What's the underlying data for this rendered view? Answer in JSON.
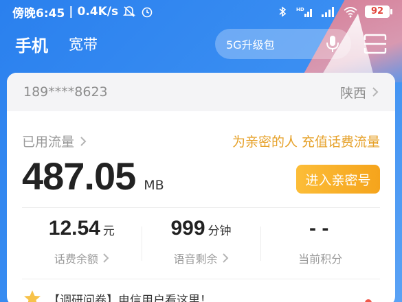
{
  "status": {
    "time": "傍晚6:45",
    "speed": "0.4K/s",
    "battery": "92"
  },
  "header": {
    "tab_phone": "手机",
    "tab_broadband": "宽带",
    "search_placeholder": "5G升级包"
  },
  "account": {
    "phone": "189****8623",
    "province": "陕西"
  },
  "usage": {
    "label": "已用流量",
    "value": "487.05",
    "unit": "MB",
    "promo": "为亲密的人 充值话费流量",
    "cta": "进入亲密号"
  },
  "stats": [
    {
      "value": "12.54",
      "unit": "元",
      "label": "话费余额"
    },
    {
      "value": "999",
      "unit": "分钟",
      "label": "语音剩余"
    },
    {
      "value": "- -",
      "unit": "",
      "label": "当前积分"
    }
  ],
  "news": {
    "text": "【调研问卷】电信用户看这里！"
  },
  "colors": {
    "brand_blue": "#2f86f0",
    "promo_orange": "#e6a129",
    "cta_yellow": "#f5a41c"
  }
}
